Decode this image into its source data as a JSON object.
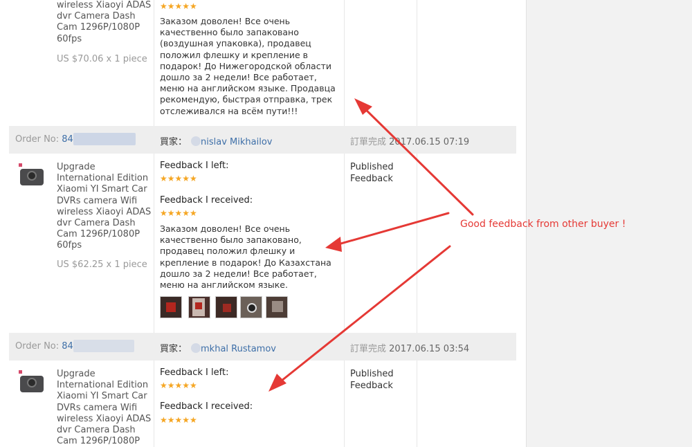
{
  "order1": {
    "product_tail": "wireless Xiaoyi ADAS dvr Camera Dash Cam 1296P/1080P 60fps",
    "price": "US $70.06 x 1 piece",
    "stars": "★★★★★",
    "review": "Заказом доволен! Все очень качественно было запаковано (воздушная упаковка), продавец положил флешку и крепление в подарок! До Нижегородской области дошло за 2 недели! Все работает, меню на английском языке. Продавца рекомендую, быстрая отправка, трек отслеживался на всём пути!!!"
  },
  "order2": {
    "order_label": "Order No:",
    "order_prefix": "84",
    "buyer_label": "買家：",
    "buyer_name": "nislav Mikhailov",
    "status": "訂單完成",
    "date": "2017.06.15 07:19",
    "product": "Upgrade International Edition Xiaomi YI Smart Car DVRs camera Wifi wireless Xiaoyi ADAS dvr Camera Dash Cam 1296P/1080P 60fps",
    "price": "US $62.25 x 1 piece",
    "feedback_left_label": "Feedback I left:",
    "feedback_left_stars": "★★★★★",
    "feedback_received_label": "Feedback I received:",
    "feedback_received_stars": "★★★★★",
    "review": "Заказом доволен! Все очень качественно было запаковано, продавец положил флешку и крепление в подарок! До Казахстана дошло за 2 недели! Все работает, меню на английском языке.",
    "published": "Published Feedback"
  },
  "order3": {
    "order_label": "Order No:",
    "order_prefix": "84",
    "buyer_label": "買家：",
    "buyer_name": "mkhal Rustamov",
    "status": "訂單完成",
    "date": "2017.06.15 03:54",
    "product": "Upgrade International Edition Xiaomi YI Smart Car DVRs camera Wifi wireless Xiaoyi ADAS dvr Camera Dash Cam 1296P/1080P",
    "feedback_left_label": "Feedback I left:",
    "feedback_left_stars": "★★★★★",
    "feedback_received_label": "Feedback I received:",
    "feedback_received_stars": "★★★★★",
    "published": "Published Feedback"
  },
  "annotation": "Good feedback from other buyer !",
  "colors": {
    "link": "#3e6fa8",
    "stars": "#f5a623",
    "annotation": "#e53935",
    "header_bg": "#eeeeee"
  }
}
